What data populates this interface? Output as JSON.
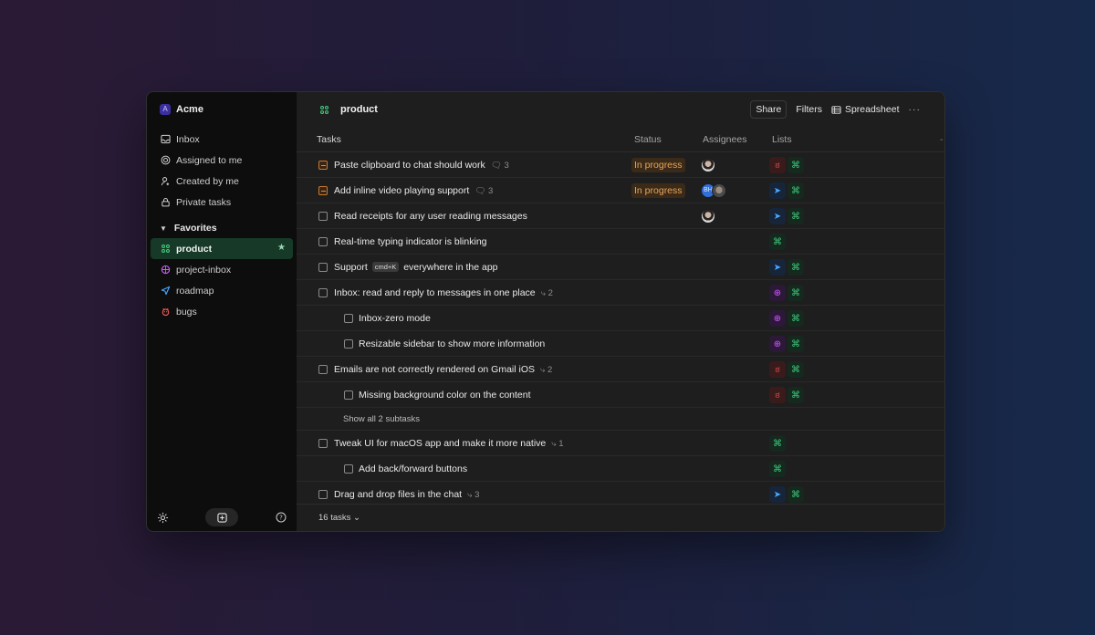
{
  "workspace": {
    "initial": "A",
    "name": "Acme"
  },
  "nav": [
    {
      "label": "Inbox",
      "icon": "inbox-icon"
    },
    {
      "label": "Assigned to me",
      "icon": "target-icon"
    },
    {
      "label": "Created by me",
      "icon": "user-icon"
    },
    {
      "label": "Private tasks",
      "icon": "lock-icon"
    }
  ],
  "favorites": {
    "label": "Favorites",
    "items": [
      {
        "label": "product",
        "icon": "product-icon",
        "active": true
      },
      {
        "label": "project-inbox",
        "icon": "project-inbox-icon"
      },
      {
        "label": "roadmap",
        "icon": "roadmap-icon"
      },
      {
        "label": "bugs",
        "icon": "bugs-icon"
      }
    ]
  },
  "header": {
    "title": "product",
    "share_label": "Share",
    "filters_label": "Filters",
    "spreadsheet_label": "Spreadsheet",
    "more_label": "···"
  },
  "table": {
    "columns": {
      "tasks": "Tasks",
      "status": "Status",
      "assignees": "Assignees",
      "lists": "Lists",
      "add": "-"
    },
    "rows": [
      {
        "title": "Paste clipboard to chat should work",
        "meta": "3"
      },
      {
        "title": "Add inline video playing support",
        "meta": "3"
      },
      {
        "title": "Read receipts for any user reading messages"
      },
      {
        "title": "Real-time typing indicator is blinking"
      },
      {
        "title_before": "Support",
        "kbd": "cmd+K",
        "title_after": "everywhere in the app"
      },
      {
        "title": "Inbox: read and reply to messages in one place",
        "meta": "2"
      },
      {
        "title": "Inbox-zero mode"
      },
      {
        "title": "Resizable sidebar to show more information"
      },
      {
        "title": "Emails are not correctly rendered on Gmail iOS",
        "meta": "2"
      },
      {
        "title": "Missing background color on the content"
      },
      {
        "showall": "Show all 2 subtasks"
      },
      {
        "title": "Tweak UI for macOS app and make it more native",
        "meta": "1"
      },
      {
        "title": "Add back/forward buttons"
      },
      {
        "title": "Drag and drop files in the chat",
        "meta": "3"
      }
    ],
    "status_in_progress": "In progress",
    "avatar_bh": "BH"
  },
  "footer": {
    "count_label": "16 tasks ⌄"
  },
  "colors": {
    "accent_product": "#3fc97a",
    "in_progress": "#e8a55e",
    "bugs": "#ff5a5a",
    "roadmap": "#4aa8ff",
    "project_inbox": "#d05bff"
  }
}
